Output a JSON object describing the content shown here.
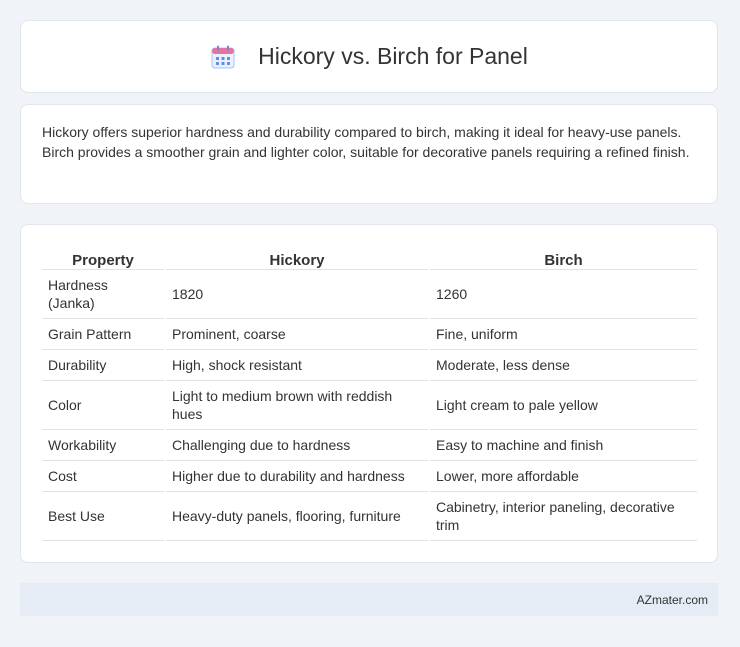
{
  "header": {
    "title": "Hickory vs. Birch for Panel",
    "icon": "calendar-icon"
  },
  "summary": {
    "text": "Hickory offers superior hardness and durability compared to birch, making it ideal for heavy-use panels. Birch provides a smoother grain and lighter color, suitable for decorative panels requiring a refined finish."
  },
  "table": {
    "headers": [
      "Property",
      "Hickory",
      "Birch"
    ],
    "rows": [
      [
        "Hardness (Janka)",
        "1820",
        "1260"
      ],
      [
        "Grain Pattern",
        "Prominent, coarse",
        "Fine, uniform"
      ],
      [
        "Durability",
        "High, shock resistant",
        "Moderate, less dense"
      ],
      [
        "Color",
        "Light to medium brown with reddish hues",
        "Light cream to pale yellow"
      ],
      [
        "Workability",
        "Challenging due to hardness",
        "Easy to machine and finish"
      ],
      [
        "Cost",
        "Higher due to durability and hardness",
        "Lower, more affordable"
      ],
      [
        "Best Use",
        "Heavy-duty panels, flooring, furniture",
        "Cabinetry, interior paneling, decorative trim"
      ]
    ]
  },
  "footer": {
    "brand": "AZmater.com"
  },
  "colors": {
    "background": "#f0f3f8",
    "footer_bg": "#e5ecf6",
    "icon_blue": "#5b8def",
    "icon_pink": "#e6739f"
  }
}
